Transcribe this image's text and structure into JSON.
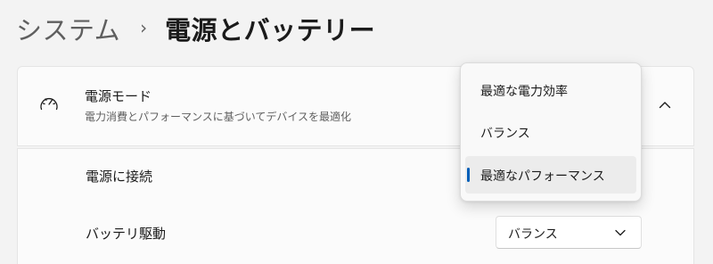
{
  "breadcrumb": {
    "parent": "システム",
    "separator": "›",
    "current": "電源とバッテリー"
  },
  "power_mode": {
    "icon": "speedometer-icon",
    "title": "電源モード",
    "description": "電力消費とパフォーマンスに基づいてデバイスを最適化",
    "collapse_icon": "chevron-up-icon"
  },
  "power_rows": {
    "plugged_in_label": "電源に接続",
    "battery_label": "バッテリ駆動",
    "battery_value": "バランス",
    "battery_chevron_icon": "chevron-down-icon"
  },
  "dropdown": {
    "options": [
      {
        "label": "最適な電力効率",
        "selected": false
      },
      {
        "label": "バランス",
        "selected": false
      },
      {
        "label": "最適なパフォーマンス",
        "selected": true
      }
    ]
  },
  "colors": {
    "accent": "#005fb8",
    "background": "#f3f3f3",
    "card": "#fbfbfb"
  }
}
